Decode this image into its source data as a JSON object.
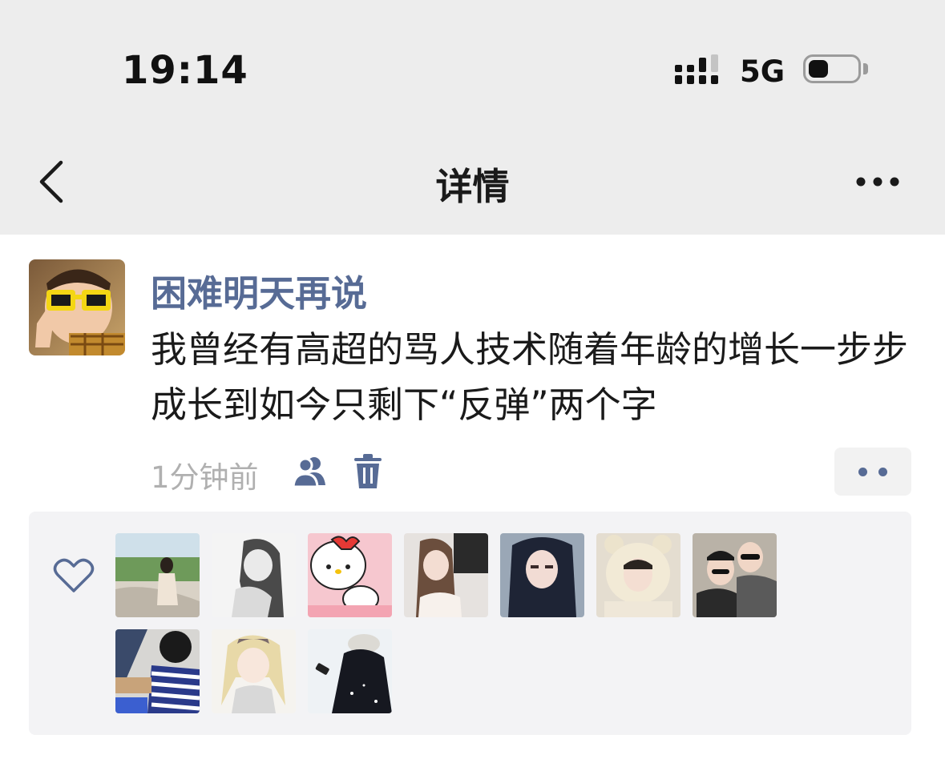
{
  "status_bar": {
    "time": "19:14",
    "network": "5G",
    "battery_level": 0.3
  },
  "nav": {
    "title": "详情",
    "back_icon": "chevron-left-icon",
    "more_icon": "more-horizontal-icon"
  },
  "post": {
    "author": "困难明天再说",
    "content": "我曾经有高超的骂人技术随着年龄的增长一步步成长到如今只剩下“反弹”两个字",
    "time_ago": "1分钟前",
    "visibility_icon": "friends-icon",
    "delete_icon": "trash-icon",
    "action_icon": "more-dots-icon"
  },
  "likes": {
    "icon": "heart-outline-icon",
    "count": 10
  },
  "colors": {
    "link_blue": "#576b95",
    "header_bg": "#ededed",
    "likes_bg": "#f3f3f5",
    "meta_gray": "#b0b0b0"
  }
}
